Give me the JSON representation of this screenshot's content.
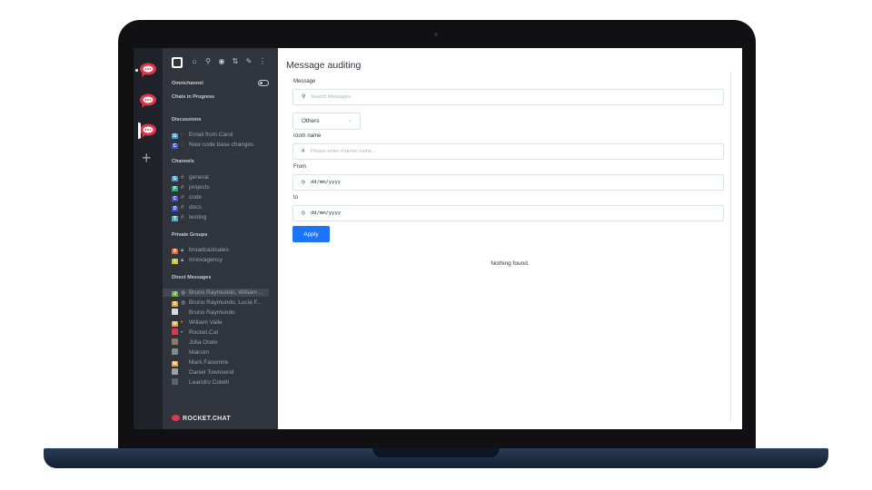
{
  "app": {
    "title": "Message auditing",
    "brand": "ROCKET.CHAT"
  },
  "sidebar": {
    "sections": {
      "omnichannel": "Omnichannel",
      "chats_in_progress": "Chats in Progress",
      "discussions": "Discussions",
      "channels": "Channels",
      "private_groups": "Private Groups",
      "direct_messages": "Direct Messages"
    },
    "discussions": [
      {
        "label": "Email from Carol",
        "initial": "G",
        "color": "#3f9ad6"
      },
      {
        "label": "New code base changes",
        "initial": "C",
        "color": "#3f57d6"
      }
    ],
    "channels": [
      {
        "label": "general",
        "initial": "G",
        "color": "#3f9ad6"
      },
      {
        "label": "projects",
        "initial": "P",
        "color": "#2fa66b"
      },
      {
        "label": "code",
        "initial": "C",
        "color": "#3f57d6"
      },
      {
        "label": "docs",
        "initial": "D",
        "color": "#3f57d6"
      },
      {
        "label": "testing",
        "initial": "T",
        "color": "#3fb8c9"
      }
    ],
    "private_groups": [
      {
        "label": "broadcastsales",
        "initial": "B",
        "color": "#e8642a"
      },
      {
        "label": "Innovagency",
        "initial": "I",
        "color": "#d9c227"
      }
    ],
    "direct_messages": [
      {
        "label": "Bruno Raymundo, William ...",
        "initial": "J",
        "color": "#6bb33a"
      },
      {
        "label": "Bruno Raymundo, Lucia F...",
        "initial": "B",
        "color": "#e8a22a"
      },
      {
        "label": "Bruno Raymundo",
        "initial": "",
        "color": "#d8dbde"
      },
      {
        "label": "William Valle",
        "initial": "W",
        "color": "#e89a2a"
      },
      {
        "label": "Rocket.Cat",
        "initial": "",
        "color": "#e0364b"
      },
      {
        "label": "Júlia Orate",
        "initial": "",
        "color": "#8a7a66"
      },
      {
        "label": "Maksim",
        "initial": "",
        "color": "#7d8a94"
      },
      {
        "label": "Mark Facemire",
        "initial": "M",
        "color": "#e8a22a"
      },
      {
        "label": "Daniel Townsend",
        "initial": "",
        "color": "#9aa0a6"
      },
      {
        "label": "Leandro Coletti",
        "initial": "",
        "color": "#5a6470"
      }
    ]
  },
  "form": {
    "message_label": "Message",
    "search_placeholder": "Search Messages",
    "type_selected": "Others",
    "room_label": "room name",
    "room_placeholder": "Please enter channel name...",
    "from_label": "From",
    "from_placeholder": "dd/mm/yyyy",
    "to_label": "to",
    "to_placeholder": "dd/mm/yyyy",
    "apply_label": "Apply",
    "empty_text": "Nothing found."
  },
  "colors": {
    "accent": "#1d74f5",
    "sidebar_bg": "#2f343d",
    "rail_bg": "#1f2329"
  }
}
